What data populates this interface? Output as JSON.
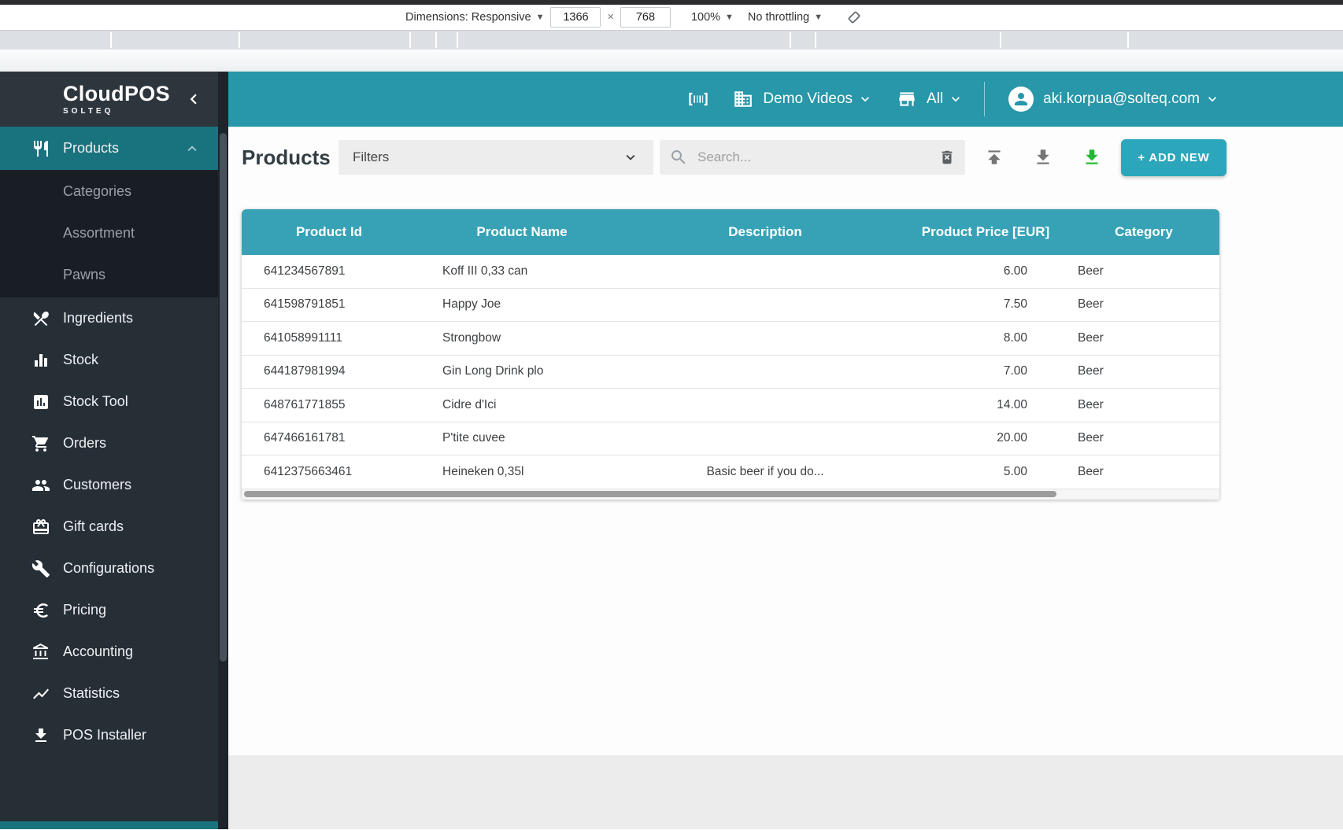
{
  "devtools": {
    "dimensions_label": "Dimensions: Responsive",
    "width_value": "1366",
    "separator": "×",
    "height_value": "768",
    "zoom_value": "100%",
    "throttling_value": "No throttling"
  },
  "header": {
    "company_selector": "Demo Videos",
    "store_selector": "All",
    "user_email": "aki.korpua@solteq.com"
  },
  "sidebar": {
    "logo_title": "CloudPOS",
    "logo_subtitle": "SOLTEQ",
    "products_label": "Products",
    "sub_items": {
      "categories": "Categories",
      "assortment": "Assortment",
      "pawns": "Pawns"
    },
    "items": [
      "Ingredients",
      "Stock",
      "Stock Tool",
      "Orders",
      "Customers",
      "Gift cards",
      "Configurations",
      "Pricing",
      "Accounting",
      "Statistics",
      "POS Installer"
    ]
  },
  "toolbar": {
    "page_title": "Products",
    "filters_label": "Filters",
    "search_placeholder": "Search...",
    "add_new_label": "+ ADD NEW"
  },
  "table": {
    "columns": [
      "Product Id",
      "Product Name",
      "Description",
      "Product Price [EUR]",
      "Category"
    ],
    "rows": [
      {
        "id": "641234567891",
        "name": "Koff III 0,33 can",
        "description": "",
        "price": "6.00",
        "category": "Beer"
      },
      {
        "id": "641598791851",
        "name": "Happy Joe",
        "description": "",
        "price": "7.50",
        "category": "Beer"
      },
      {
        "id": "641058991111",
        "name": "Strongbow",
        "description": "",
        "price": "8.00",
        "category": "Beer"
      },
      {
        "id": "644187981994",
        "name": "Gin Long Drink plo",
        "description": "",
        "price": "7.00",
        "category": "Beer"
      },
      {
        "id": "648761771855",
        "name": "Cidre d'Ici",
        "description": "",
        "price": "14.00",
        "category": "Beer"
      },
      {
        "id": "647466161781",
        "name": "P'tite cuvee",
        "description": "",
        "price": "20.00",
        "category": "Beer"
      },
      {
        "id": "6412375663461",
        "name": "Heineken 0,35l",
        "description": "Basic beer if you do...",
        "price": "5.00",
        "category": "Beer"
      }
    ]
  },
  "icons": {
    "barcode-scanner-icon": "bracketed barcode bars",
    "building-icon": "office building",
    "storefront-icon": "store front",
    "user-avatar-icon": "person in circle",
    "utensils-icon": "fork and knife",
    "crossed-utensils-icon": "crossed fork and spoon",
    "bar-chart-icon": "equalizer bars",
    "chart-box-icon": "bar chart in rounded square",
    "cart-icon": "shopping cart",
    "people-icon": "two people",
    "gift-icon": "gift card with bow",
    "wrench-icon": "wrench",
    "euro-icon": "euro sign",
    "bank-icon": "bank columns",
    "trend-icon": "trending line",
    "download-icon": "arrow down with bar",
    "upload-icon": "arrow up with bar",
    "search-icon": "magnifier",
    "clear-search-icon": "trash can with x",
    "chevron-down-icon": "v",
    "chevron-up-icon": "^",
    "chevron-left-icon": "<",
    "rotate-viewport-icon": "rotated rectangle"
  },
  "colors": {
    "header_teal": "#2797a9",
    "table_header_teal": "#37a2b6",
    "button_teal": "#2ba6ba",
    "sidebar_bg": "#262e36",
    "sidebar_active_teal": "#19737e",
    "export_green": "#22b833"
  }
}
